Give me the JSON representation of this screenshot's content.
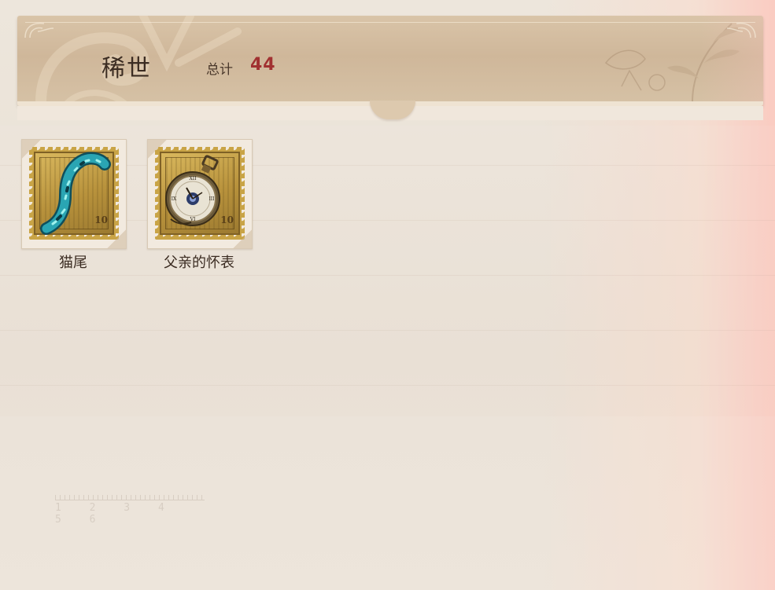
{
  "header": {
    "title": "稀世",
    "total_label": "总计",
    "total_value": "44"
  },
  "items": [
    {
      "name": "猫尾",
      "icon": "cat-tail-icon",
      "denomination": "10"
    },
    {
      "name": "父亲的怀表",
      "icon": "pocket-watch-icon",
      "denomination": "10"
    }
  ],
  "ruler": {
    "numbers": "1 2 3 4 5 6"
  },
  "colors": {
    "total_value": "#a13131",
    "title": "#3b2c22",
    "stamp_gold": "#c9a446"
  }
}
